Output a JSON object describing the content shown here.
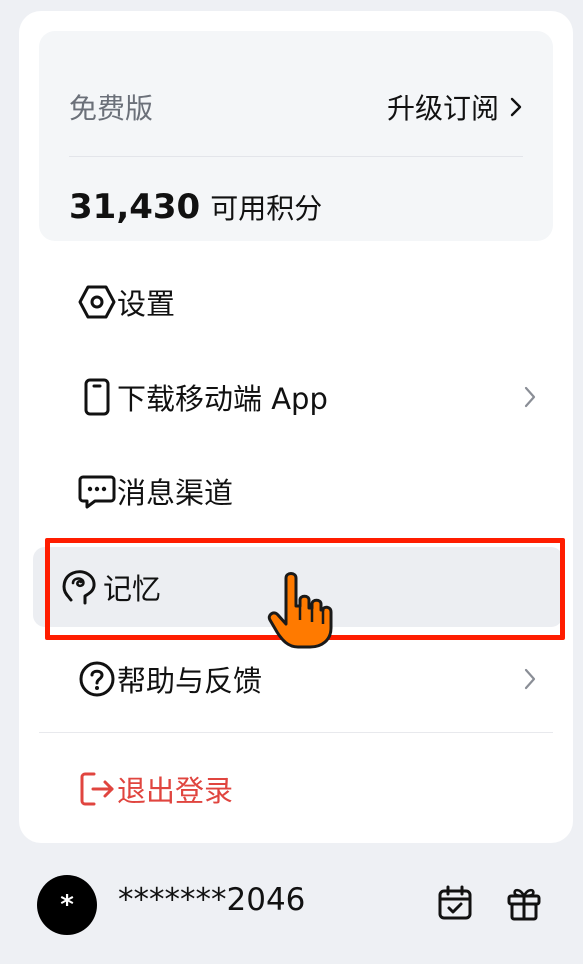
{
  "plan": {
    "name": "免费版",
    "upgrade_label": "升级订阅",
    "credits_value": "31,430",
    "credits_label": "可用积分"
  },
  "menu": {
    "items": [
      {
        "label": "设置",
        "icon": "hexagon-settings-icon"
      },
      {
        "label": "下载移动端 App",
        "icon": "mobile-phone-icon",
        "has_arrow": true
      },
      {
        "label": "消息渠道",
        "icon": "chat-bubble-icon"
      },
      {
        "label": "记忆",
        "icon": "brain-memory-icon",
        "highlighted": true
      },
      {
        "label": "帮助与反馈",
        "icon": "question-circle-icon",
        "has_arrow": true
      }
    ],
    "logout_label": "退出登录"
  },
  "user": {
    "avatar_text": "*",
    "name": "*******2046"
  },
  "colors": {
    "logout": "#e0453f",
    "highlight_border": "#ff1d00",
    "cursor": "#ff7a00"
  }
}
